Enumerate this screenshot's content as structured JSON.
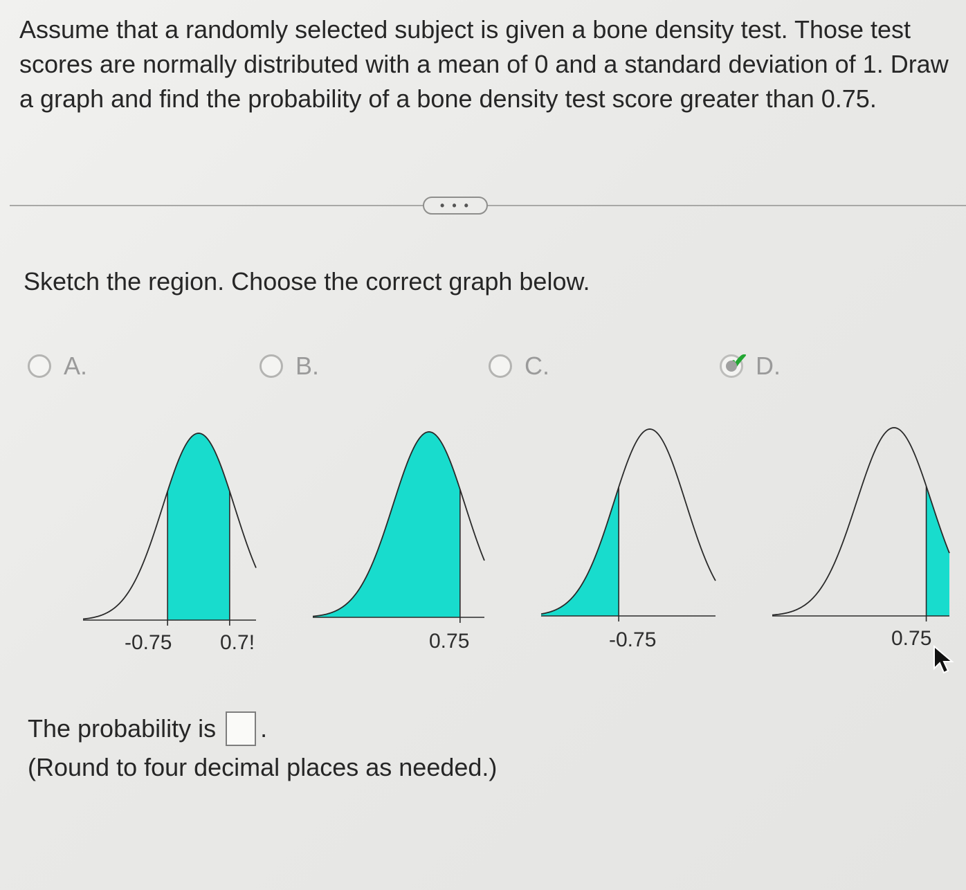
{
  "question": {
    "text": "Assume that a randomly selected subject is given a bone density test. Those test scores are normally distributed with a mean of 0 and a standard deviation of 1. Draw a graph and find the probability of a bone density test score greater than 0.75."
  },
  "more_button": {
    "label": "• • •"
  },
  "instruction": "Sketch the region. Choose the correct graph below.",
  "options": [
    {
      "letter": "A.",
      "selected": false,
      "shade": "between",
      "bounds": [
        -0.75,
        0.75
      ],
      "tick_labels": [
        "-0.75",
        "0.7!"
      ]
    },
    {
      "letter": "B.",
      "selected": false,
      "shade": "left",
      "bounds": [
        0.75
      ],
      "tick_labels": [
        "0.75"
      ]
    },
    {
      "letter": "C.",
      "selected": false,
      "shade": "left",
      "bounds": [
        -0.75
      ],
      "tick_labels": [
        "-0.75"
      ]
    },
    {
      "letter": "D.",
      "selected": true,
      "shade": "right",
      "bounds": [
        0.75
      ],
      "tick_labels": [
        "0.75"
      ]
    }
  ],
  "answer": {
    "prefix": "The probability is",
    "value": "",
    "suffix": "."
  },
  "hint": "(Round to four decimal places as needed.)",
  "colors": {
    "shade": "#18dccd",
    "curve": "#2a2a2a",
    "check": "#22a632"
  },
  "icons": {
    "check": "check-icon",
    "cursor": "mouse-pointer-icon"
  }
}
